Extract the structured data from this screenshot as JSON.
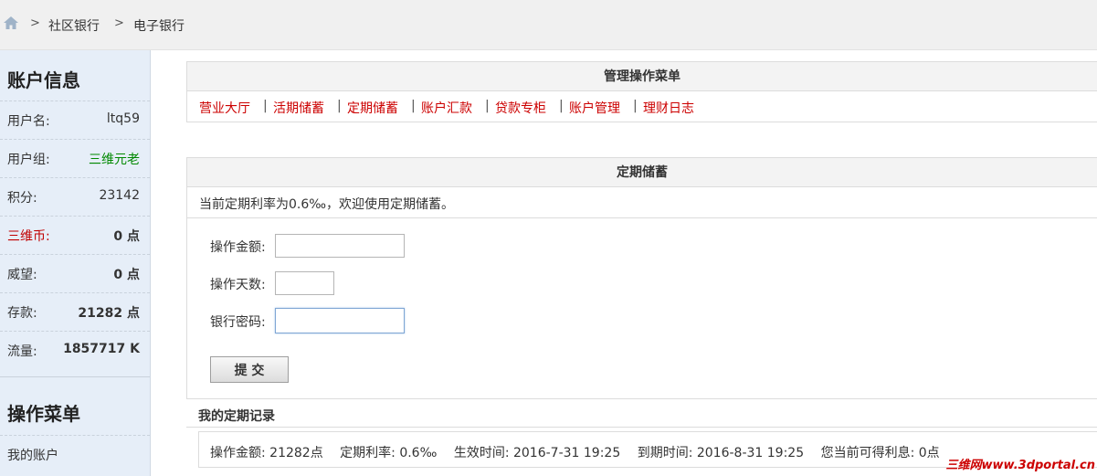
{
  "breadcrumb": {
    "items": [
      "社区银行",
      "电子银行"
    ],
    "separator": ">"
  },
  "sidebar": {
    "account_title": "账户信息",
    "account_rows": [
      {
        "label": "用户名:",
        "value": "ltq59"
      },
      {
        "label": "用户组:",
        "value": "三维元老"
      },
      {
        "label": "积分:",
        "value": "23142"
      },
      {
        "label": "三维币:",
        "value": "0 点"
      },
      {
        "label": "威望:",
        "value": "0 点"
      },
      {
        "label": "存款:",
        "value": "21282 点"
      },
      {
        "label": "流量:",
        "value": "1857717 K"
      }
    ],
    "menu_title": "操作菜单",
    "menu_items": [
      "我的账户"
    ]
  },
  "main": {
    "menu_panel_title": "管理操作菜单",
    "menu_links": [
      "营业大厅",
      "活期储蓄",
      "定期储蓄",
      "账户汇款",
      "贷款专柜",
      "账户管理",
      "理财日志"
    ],
    "menu_separator": "|",
    "fixed_panel_title": "定期储蓄",
    "rate_notice": "当前定期利率为0.6‰，欢迎使用定期储蓄。",
    "form": {
      "amount_label": "操作金额:",
      "amount_value": "",
      "days_label": "操作天数:",
      "days_value": "",
      "password_label": "银行密码:",
      "password_value": "",
      "submit_label": "提 交"
    },
    "records_title": "我的定期记录",
    "record": {
      "amount": "操作金额: 21282点",
      "rate": "定期利率: 0.6‰",
      "start": "生效时间: 2016-7-31 19:25",
      "end": "到期时间: 2016-8-31 19:25",
      "interest": "您当前可得利息: 0点"
    }
  },
  "watermark": "三维网www.3dportal.cn",
  "colors": {
    "link_red": "#cc0000",
    "group_green": "#008800",
    "sidebar_bg": "#e6eef8"
  }
}
